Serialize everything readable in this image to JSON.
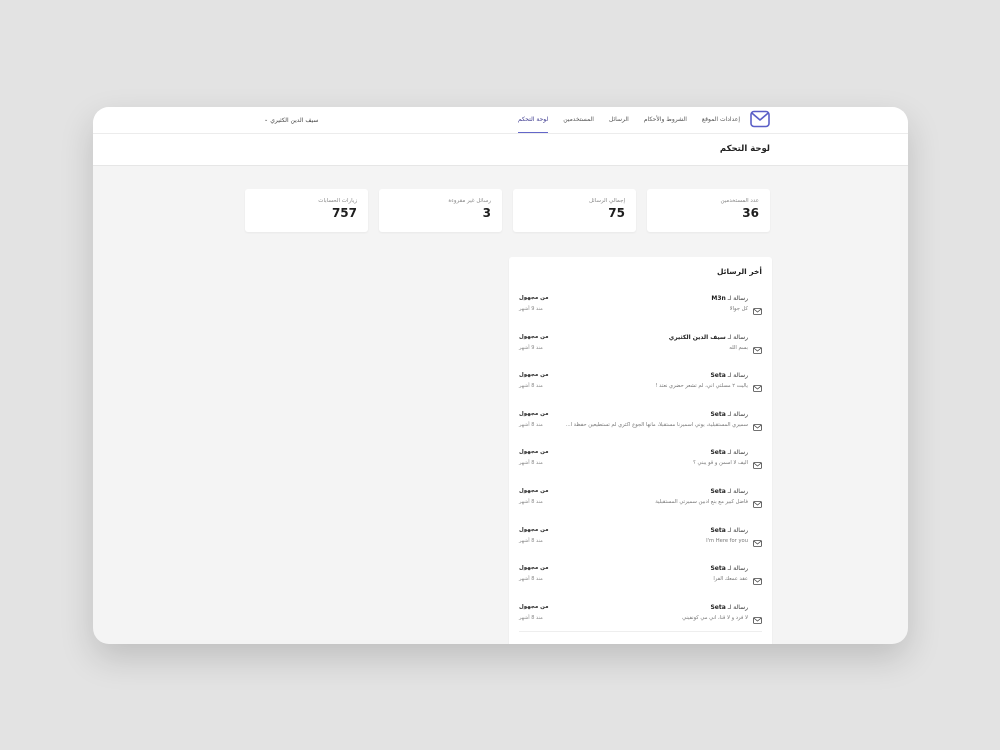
{
  "nav": {
    "links": [
      "لوحة التحكم",
      "المستخدمين",
      "الرسائل",
      "الشروط والأحكام",
      "إعدادات الموقع"
    ],
    "active_index": 0,
    "user": "سيف الدين الكثيري",
    "caret": "⌄"
  },
  "page": {
    "title": "لوحة التحكم"
  },
  "stats": [
    {
      "label": "عدد المستخدمين",
      "value": "36"
    },
    {
      "label": "إجمالي الرسائل",
      "value": "75"
    },
    {
      "label": "رسائل غير مقروءة",
      "value": "3"
    },
    {
      "label": "زيارات الحسابات",
      "value": "757"
    }
  ],
  "messages_panel": {
    "title": "أخر الرسائل",
    "prefix": "رسالة لـ",
    "items": [
      {
        "to": "M3n",
        "preview": "كل جوالا",
        "from": "من مجهول",
        "time": "منذ 9 أشهر"
      },
      {
        "to": "سيف الدين الكثيري",
        "preview": "بسم الله",
        "from": "من مجهول",
        "time": "منذ 9 أشهر"
      },
      {
        "to": "Seta",
        "preview": "ياليت ٢ مسلتي أني، لم تشعر حضري نعتذ !",
        "from": "من مجهول",
        "time": "منذ 8 أشهر"
      },
      {
        "to": "Seta",
        "preview": "سميري المستقبلية، يوني أسميرنا مستقبلا، مانها الجوع أكثري لم تستطيعين حفظة أ...",
        "from": "من مجهول",
        "time": "منذ 8 أشهر"
      },
      {
        "to": "Seta",
        "preview": "أليف لا أسمن و قو يبني ؟",
        "from": "من مجهول",
        "time": "منذ 8 أشهر"
      },
      {
        "to": "Seta",
        "preview": "فاضل كبير مع بنع أدبين سميرتي المستقبلية",
        "from": "من مجهول",
        "time": "منذ 8 أشهر"
      },
      {
        "to": "Seta",
        "preview": "I'm Here for you",
        "from": "من مجهول",
        "time": "منذ 8 أشهر"
      },
      {
        "to": "Seta",
        "preview": "عقد عمعك الفرا",
        "from": "من مجهول",
        "time": "منذ 8 أشهر"
      },
      {
        "to": "Seta",
        "preview": "لا فرد و لا قنا، أني مي كونفيني",
        "from": "من مجهول",
        "time": "منذ 8 أشهر"
      }
    ]
  },
  "colors": {
    "accent": "#6366c9",
    "accent_dark": "#3d3a8f",
    "page_bg": "#f4f4f4"
  },
  "icons": {
    "logo": "envelope-logo-icon",
    "message": "envelope-icon"
  }
}
